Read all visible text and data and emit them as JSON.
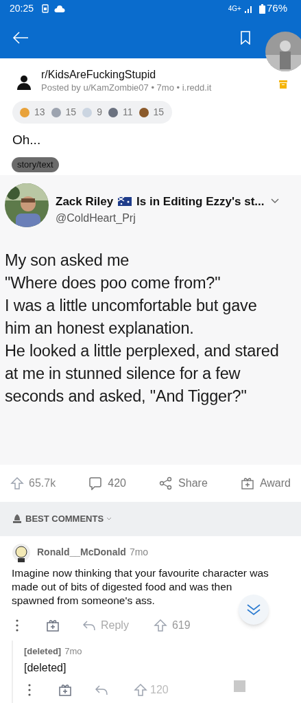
{
  "status_bar": {
    "time": "20:25",
    "network": "4G+",
    "battery": "76%"
  },
  "post": {
    "subreddit": "r/KidsAreFuckingStupid",
    "byline": "Posted by u/KamZombie07 • 7mo • i.redd.it",
    "awards": [
      {
        "count": "13"
      },
      {
        "count": "15"
      },
      {
        "count": "9"
      },
      {
        "count": "11"
      },
      {
        "count": "15"
      }
    ],
    "title": "Oh...",
    "flair": "story/text",
    "tweet": {
      "name": "Zack Riley",
      "status": "Is in Editing Ezzy's st...",
      "handle": "@ColdHeart_Prj",
      "lines": [
        "My son asked me",
        "\"Where does poo come from?\"",
        "I was a little uncomfortable but gave him an honest explanation.",
        "He looked a little perplexed, and stared at me in stunned silence for a few seconds and asked, \"And Tigger?\""
      ]
    },
    "actions": {
      "upvotes": "65.7k",
      "comments": "420",
      "share": "Share",
      "award": "Award"
    }
  },
  "sort": "BEST COMMENTS",
  "comments": [
    {
      "author": "Ronald__McDonald",
      "age": "7mo",
      "text": "Imagine now thinking that your favourite character was made out of bits of digested food and was then spawned from someone's ass.",
      "reply": "Reply",
      "score": "619",
      "children": [
        {
          "author": "[deleted]",
          "age": "7mo",
          "text": "[deleted]",
          "score": "120"
        }
      ]
    }
  ]
}
